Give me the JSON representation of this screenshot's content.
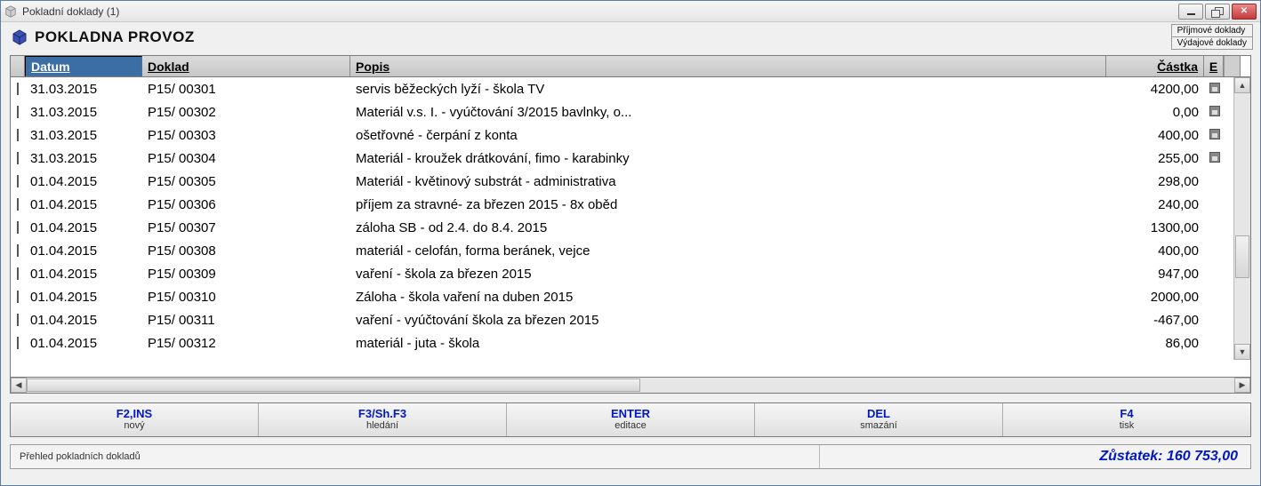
{
  "window": {
    "title": "Pokladní doklady (1)"
  },
  "header": {
    "title": "POKLADNA PROVOZ",
    "links": {
      "income": "Příjmové doklady",
      "expense": "Výdajové doklady"
    }
  },
  "columns": {
    "datum": "Datum",
    "doklad": "Doklad",
    "popis": "Popis",
    "castka": "Částka",
    "e": "E"
  },
  "rows": [
    {
      "datum": "31.03.2015",
      "doklad": "P15/ 00301",
      "popis": "servis běžeckých lyží - škola TV",
      "castka": "4200,00",
      "saved": true
    },
    {
      "datum": "31.03.2015",
      "doklad": "P15/ 00302",
      "popis": "Materiál v.s. I. - vyúčtování 3/2015 bavlnky, o...",
      "castka": "0,00",
      "saved": true
    },
    {
      "datum": "31.03.2015",
      "doklad": "P15/ 00303",
      "popis": "ošetřovné - čerpání z konta",
      "castka": "400,00",
      "saved": true
    },
    {
      "datum": "31.03.2015",
      "doklad": "P15/ 00304",
      "popis": "Materiál - kroužek drátkování, fimo - karabinky",
      "castka": "255,00",
      "saved": true
    },
    {
      "datum": "01.04.2015",
      "doklad": "P15/ 00305",
      "popis": "Materiál - květinový substrát - administrativa",
      "castka": "298,00",
      "saved": false
    },
    {
      "datum": "01.04.2015",
      "doklad": "P15/ 00306",
      "popis": "příjem za stravné-  za březen 2015 - 8x oběd",
      "castka": "240,00",
      "saved": false
    },
    {
      "datum": "01.04.2015",
      "doklad": "P15/ 00307",
      "popis": "záloha SB - od 2.4. do  8.4. 2015",
      "castka": "1300,00",
      "saved": false
    },
    {
      "datum": "01.04.2015",
      "doklad": "P15/ 00308",
      "popis": "materiál - celofán, forma beránek, vejce",
      "castka": "400,00",
      "saved": false
    },
    {
      "datum": "01.04.2015",
      "doklad": "P15/ 00309",
      "popis": "vaření - škola za březen 2015",
      "castka": "947,00",
      "saved": false
    },
    {
      "datum": "01.04.2015",
      "doklad": "P15/ 00310",
      "popis": "Záloha - škola vaření  na duben 2015",
      "castka": "2000,00",
      "saved": false
    },
    {
      "datum": "01.04.2015",
      "doklad": "P15/ 00311",
      "popis": "vaření - vyúčtování škola za březen 2015",
      "castka": "-467,00",
      "saved": false
    },
    {
      "datum": "01.04.2015",
      "doklad": "P15/ 00312",
      "popis": "materiál - juta - škola",
      "castka": "86,00",
      "saved": false
    }
  ],
  "fnbar": {
    "f2": {
      "key": "F2,INS",
      "label": "nový"
    },
    "f3": {
      "key": "F3/Sh.F3",
      "label": "hledání"
    },
    "en": {
      "key": "ENTER",
      "label": "editace"
    },
    "de": {
      "key": "DEL",
      "label": "smazání"
    },
    "f4": {
      "key": "F4",
      "label": "tisk"
    }
  },
  "status": {
    "left": "Přehled pokladních dokladů",
    "balance_label": "Zůstatek:",
    "balance_value": "160 753,00"
  }
}
